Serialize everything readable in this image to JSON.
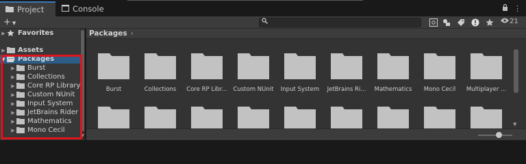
{
  "tabs": [
    {
      "label": "Project",
      "icon": "folder-icon",
      "active": true
    },
    {
      "label": "Console",
      "icon": "console-icon",
      "active": false
    }
  ],
  "window_controls": {
    "lock": "🔒",
    "menu": "⋮"
  },
  "toolbar": {
    "add_label": "+",
    "search_value": "",
    "hidden_packages_count": "21"
  },
  "tree": {
    "items": [
      {
        "label": "Favorites",
        "icon": "star-icon",
        "bold": true,
        "expanded": false
      },
      {
        "label": "Assets",
        "icon": "folder-icon",
        "bold": true,
        "expanded": false
      },
      {
        "label": "Packages",
        "icon": "folder-open-icon",
        "bold": true,
        "expanded": true,
        "selected": true
      },
      {
        "label": "Burst",
        "icon": "folder-icon"
      },
      {
        "label": "Collections",
        "icon": "folder-icon"
      },
      {
        "label": "Core RP Library",
        "icon": "folder-icon"
      },
      {
        "label": "Custom NUnit",
        "icon": "folder-icon"
      },
      {
        "label": "Input System",
        "icon": "folder-icon"
      },
      {
        "label": "JetBrains Rider",
        "icon": "folder-icon"
      },
      {
        "label": "Mathematics",
        "icon": "folder-icon"
      },
      {
        "label": "Mono Cecil",
        "icon": "folder-icon"
      }
    ]
  },
  "content": {
    "breadcrumb": "Packages",
    "folders": [
      "Burst",
      "Collections",
      "Core RP Libr...",
      "Custom NUnit",
      "Input System",
      "JetBrains Ri...",
      "Mathematics",
      "Mono Cecil",
      "Multiplayer ..."
    ]
  },
  "colors": {
    "selection": "#2c5d87",
    "highlight_box": "#e0141b",
    "folder": "#c2c2c2",
    "tab_accent": "#3a79bb"
  }
}
